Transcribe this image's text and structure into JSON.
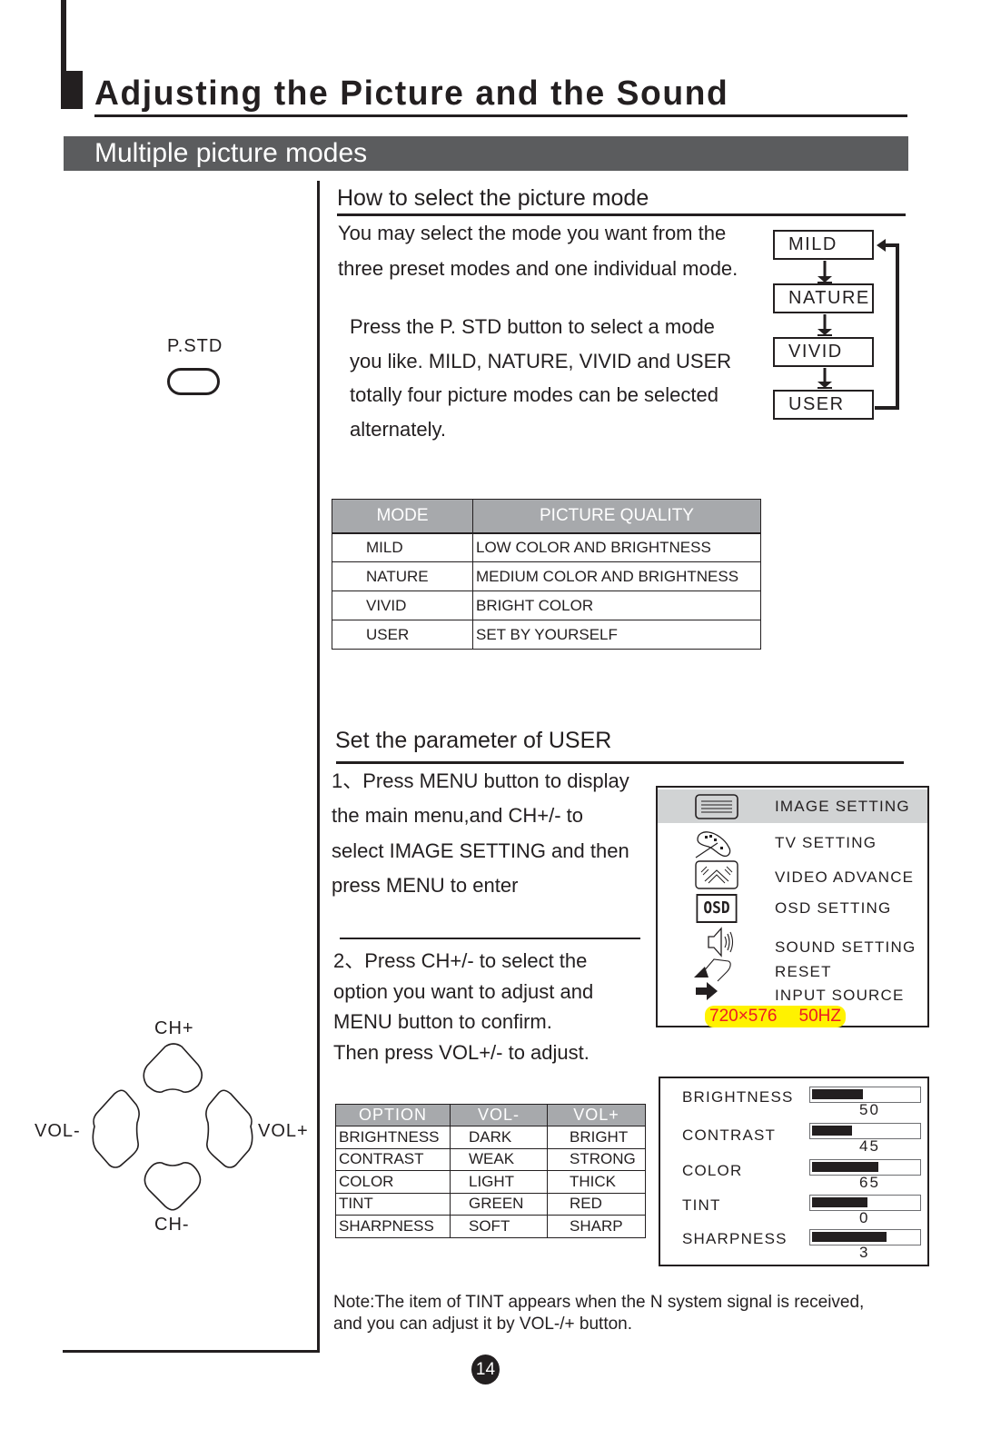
{
  "header": {
    "title": "Adjusting the Picture and the Sound",
    "section": "Multiple picture modes"
  },
  "remote": {
    "pstd_label": "P.STD",
    "dpad": {
      "up": "CH+",
      "down": "CH-",
      "left": "VOL-",
      "right": "VOL+"
    }
  },
  "select_mode": {
    "heading": "How to select the picture mode",
    "intro_lines": [
      "You may select the mode you want  from the",
      "three preset modes and one individual mode."
    ],
    "instruction_lines": [
      "Press the P. STD button to select a mode",
      "you like. MILD, NATURE, VIVID and USER",
      "totally four picture modes  can be selected",
      "alternately."
    ],
    "flow": [
      "MILD",
      "NATURE",
      "VIVID",
      "USER"
    ]
  },
  "mode_table": {
    "headers": [
      "MODE",
      "PICTURE QUALITY"
    ],
    "rows": [
      [
        "MILD",
        "LOW COLOR AND BRIGHTNESS"
      ],
      [
        "NATURE",
        "MEDIUM COLOR AND BRIGHTNESS"
      ],
      [
        "VIVID",
        "BRIGHT COLOR"
      ],
      [
        "USER",
        "SET BY YOURSELF"
      ]
    ]
  },
  "user_params": {
    "heading": "Set the parameter of USER",
    "step1_lines": [
      "1、Press MENU button to display",
      "the main menu,and CH+/- to",
      "select IMAGE SETTING and then",
      "press MENU to enter"
    ],
    "step2_lines": [
      "2、Press CH+/- to select the",
      "option you want to adjust and",
      "MENU button to confirm.",
      "Then press VOL+/- to adjust."
    ]
  },
  "osd_menu": {
    "items": [
      {
        "label": "IMAGE SETTING",
        "icon": "image-setting-icon",
        "selected": true
      },
      {
        "label": "TV SETTING",
        "icon": "tv-setting-icon",
        "selected": false
      },
      {
        "label": "VIDEO ADVANCE",
        "icon": "video-advance-icon",
        "selected": false
      },
      {
        "label": "OSD SETTING",
        "icon": "osd-icon",
        "selected": false
      },
      {
        "label": "SOUND SETTING",
        "icon": "speaker-icon",
        "selected": false
      },
      {
        "label": "RESET",
        "icon": "reset-arrow-icon",
        "selected": false
      },
      {
        "label": "INPUT SOURCE",
        "icon": "right-arrow-icon",
        "selected": false
      }
    ],
    "osd_icon_text": "OSD",
    "resolution": "720×576",
    "refresh": "50HZ",
    "highlight_color": "#fff200",
    "resolution_color": "#ed1c24",
    "selected_row_color": "#d1d3d4"
  },
  "option_table": {
    "headers": [
      "OPTION",
      "VOL-",
      "VOL+"
    ],
    "rows": [
      [
        "BRIGHTNESS",
        "DARK",
        "BRIGHT"
      ],
      [
        "CONTRAST",
        "WEAK",
        "STRONG"
      ],
      [
        "COLOR",
        "LIGHT",
        "THICK"
      ],
      [
        "TINT",
        "GREEN",
        "RED"
      ],
      [
        "SHARPNESS",
        "SOFT",
        "SHARP"
      ]
    ]
  },
  "sliders": [
    {
      "label": "BRIGHTNESS",
      "value": "50",
      "fill_fraction": 0.48
    },
    {
      "label": "CONTRAST",
      "value": "45",
      "fill_fraction": 0.38
    },
    {
      "label": "COLOR",
      "value": "65",
      "fill_fraction": 0.63
    },
    {
      "label": "TINT",
      "value": "0",
      "fill_fraction": 0.53
    },
    {
      "label": "SHARPNESS",
      "value": "3",
      "fill_fraction": 0.71
    }
  ],
  "note_lines": [
    "Note:The item of TINT appears when the N system signal is received,",
    "and you can adjust it by  VOL-/+ button."
  ],
  "page_number": "14",
  "colors": {
    "ink": "#231f20",
    "section_bar": "#5b5c5e",
    "table_header": "#a7a9ac"
  }
}
